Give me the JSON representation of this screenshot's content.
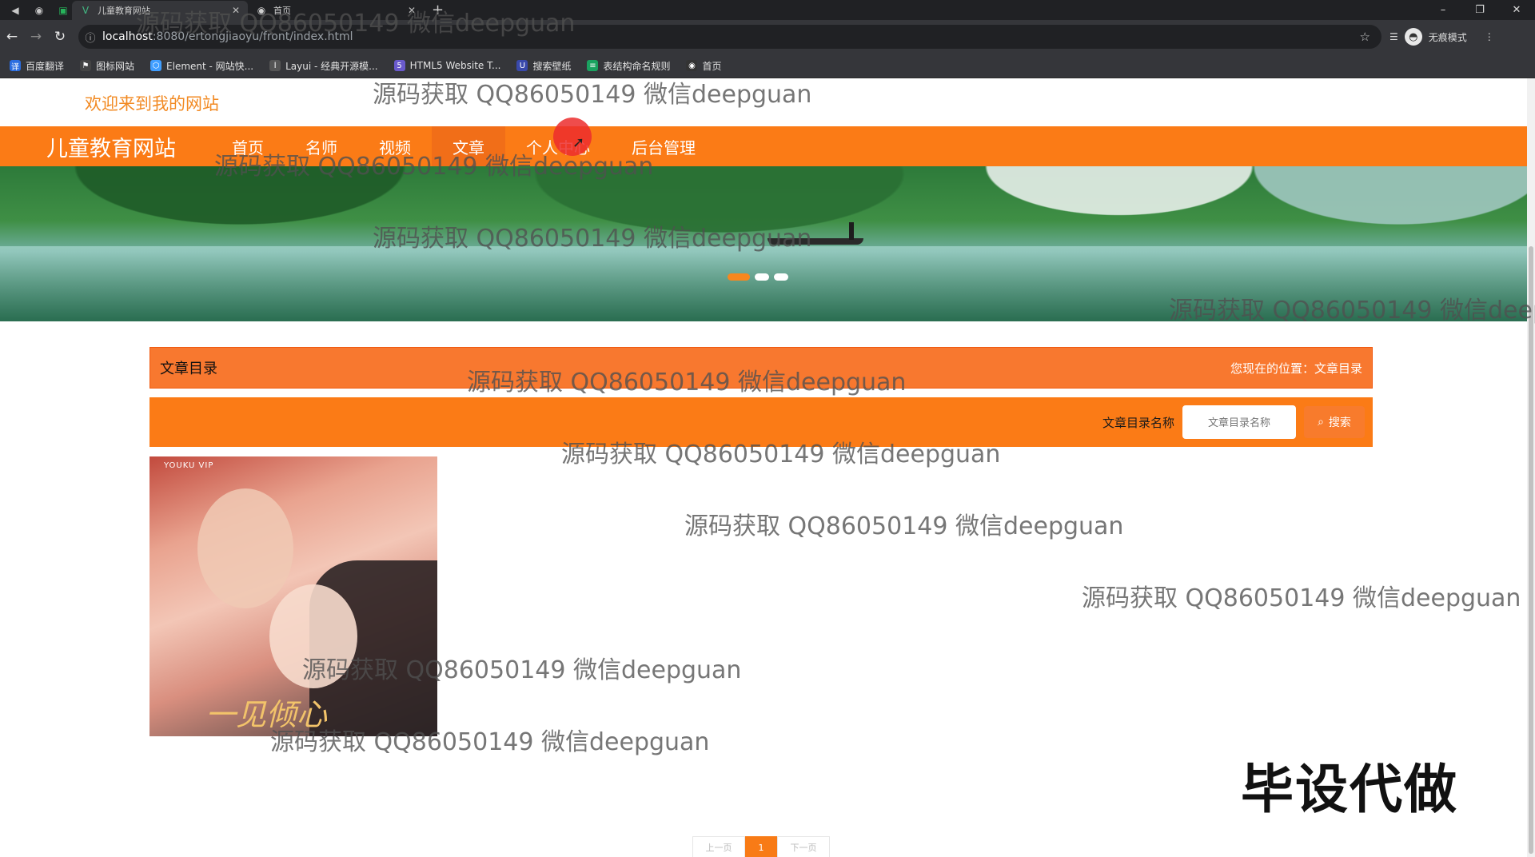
{
  "browser": {
    "tabs": [
      {
        "title": "儿童教育网站",
        "active": true
      },
      {
        "title": "首页",
        "active": false
      }
    ],
    "url_host": "localhost",
    "url_path": ":8080/ertongjiaoyu/front/index.html",
    "profile_label": "无痕模式",
    "bookmarks": [
      "百度翻译",
      "图标网站",
      "Element - 网站快...",
      "Layui - 经典开源模...",
      "HTML5 Website T...",
      "搜索壁纸",
      "表结构命名规则",
      "首页"
    ]
  },
  "site": {
    "welcome": "欢迎来到我的网站",
    "title": "儿童教育网站",
    "nav": [
      "首页",
      "名师",
      "视频",
      "文章",
      "个人中心",
      "后台管理"
    ]
  },
  "catalog": {
    "heading": "文章目录",
    "location": "您现在的位置：文章目录",
    "search_label": "文章目录名称",
    "search_placeholder": "文章目录名称",
    "search_button": "搜索"
  },
  "card": {
    "tag": "YOUKU VIP",
    "logo_text": "一见倾心"
  },
  "pagination": {
    "prev": "上一页",
    "current": "1",
    "next": "下一页"
  },
  "overlay": {
    "stamp": "毕设代做",
    "watermark": "源码获取 QQ86050149 微信deepguan"
  },
  "colors": {
    "accent": "#fb7b16",
    "welcome": "#f28a23"
  }
}
